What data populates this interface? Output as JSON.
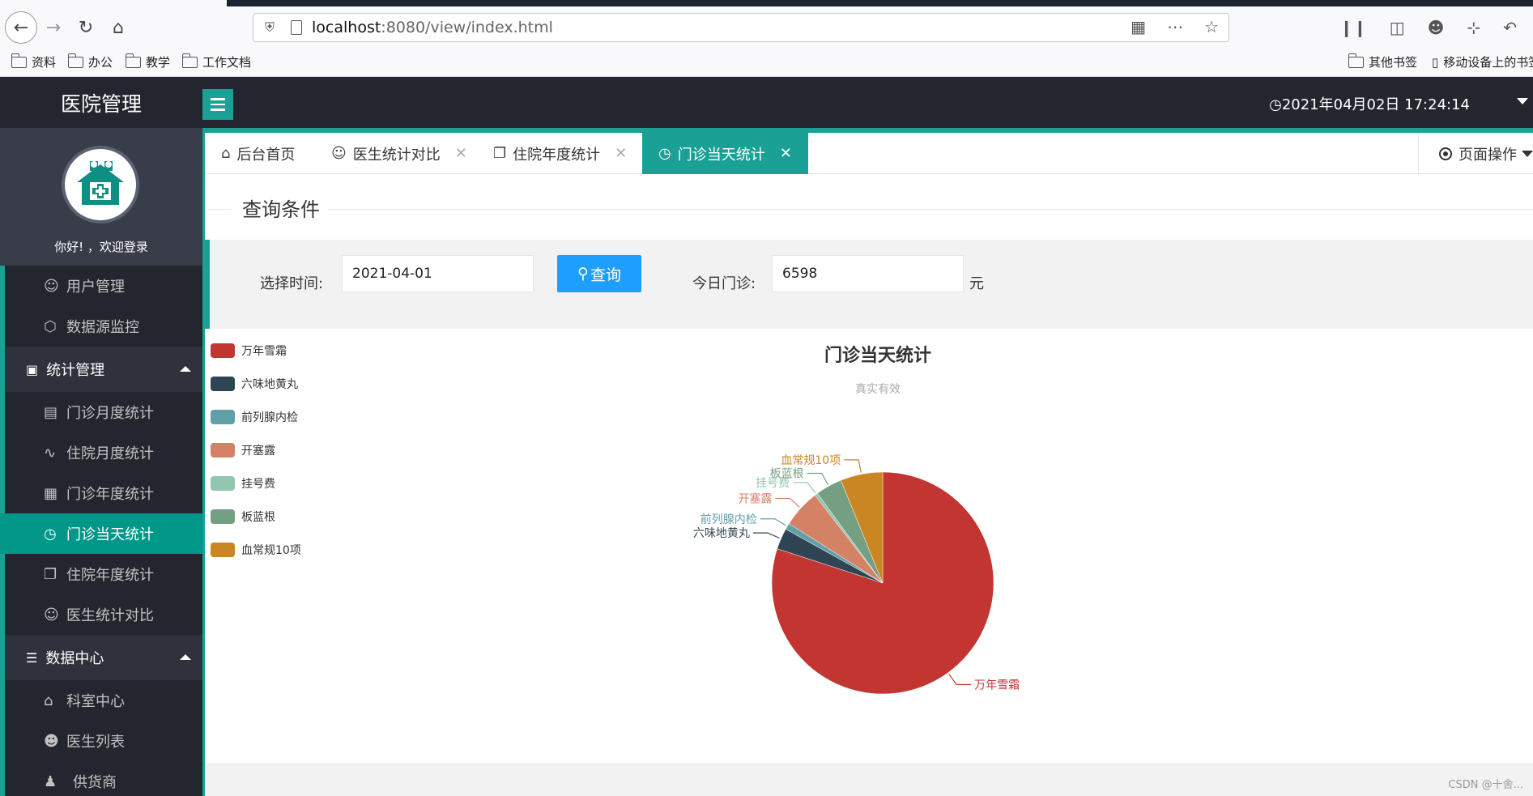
{
  "browser": {
    "url_host": "localhost",
    "url_rest": ":8080/view/index.html",
    "bookmarks": [
      "资料",
      "办公",
      "教学",
      "工作文档"
    ],
    "bookmarks_right": [
      "其他书签",
      "移动设备上的书签"
    ]
  },
  "header": {
    "app_title": "医院管理",
    "clock": "2021年04月02日 17:24:14"
  },
  "sidebar": {
    "welcome": "你好! ，欢迎登录",
    "items_top": [
      {
        "label": "用户管理",
        "icon": "user-icon"
      },
      {
        "label": "数据源监控",
        "icon": "cube-icon"
      }
    ],
    "group1": {
      "label": "统计管理",
      "icon": "presentation-icon"
    },
    "group1_items": [
      {
        "label": "门诊月度统计",
        "icon": "clipboard-icon",
        "active": false
      },
      {
        "label": "住院月度统计",
        "icon": "pulse-icon",
        "active": false
      },
      {
        "label": "门诊年度统计",
        "icon": "table-icon",
        "active": false
      },
      {
        "label": "门诊当天统计",
        "icon": "clock-icon",
        "active": true
      },
      {
        "label": "住院年度统计",
        "icon": "copy-icon",
        "active": false
      },
      {
        "label": "医生统计对比",
        "icon": "user-icon",
        "active": false
      }
    ],
    "group2": {
      "label": "数据中心",
      "icon": "document-icon"
    },
    "group2_items": [
      {
        "label": "科室中心",
        "icon": "home-icon"
      },
      {
        "label": "医生列表",
        "icon": "person-icon"
      },
      {
        "label": "供货商",
        "icon": "users-icon"
      }
    ]
  },
  "tabs": [
    {
      "label": "后台首页",
      "icon": "home-icon",
      "closable": false,
      "active": false
    },
    {
      "label": "医生统计对比",
      "icon": "user-icon",
      "closable": true,
      "active": false
    },
    {
      "label": "住院年度统计",
      "icon": "copy-icon",
      "closable": true,
      "active": false
    },
    {
      "label": "门诊当天统计",
      "icon": "clock-icon",
      "closable": true,
      "active": true
    }
  ],
  "page_ops": "页面操作",
  "query": {
    "section_title": "查询条件",
    "date_label": "选择时间:",
    "date_value": "2021-04-01",
    "search_button": "查询",
    "today_label": "今日门诊:",
    "today_value": "6598",
    "unit": "元"
  },
  "chart_data": {
    "type": "pie",
    "title": "门诊当天统计",
    "subtitle": "真实有效",
    "legend_position": "left",
    "categories": [
      "万年雪霜",
      "六味地黄丸",
      "前列腺内检",
      "开塞露",
      "挂号费",
      "板蓝根",
      "血常规10项"
    ],
    "values": [
      5200,
      200,
      60,
      360,
      30,
      250,
      400
    ],
    "colors": [
      "#c23531",
      "#2f4554",
      "#61a0a8",
      "#d48265",
      "#91c7ae",
      "#749f83",
      "#ca8622"
    ]
  },
  "watermark": "CSDN @十舍..."
}
